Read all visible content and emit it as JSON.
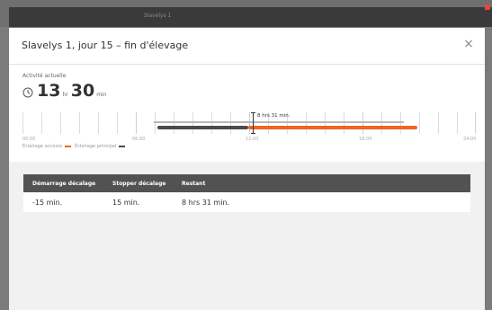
{
  "window": {
    "title": "Slavelys 1"
  },
  "dialog": {
    "title": "Slavelys 1, jour 15 – fin d'élevage",
    "close_label": "×"
  },
  "activity": {
    "label": "Activité actuelle",
    "hours": "13",
    "hours_unit": "hr",
    "minutes": "30",
    "minutes_unit": "min"
  },
  "timeline": {
    "marker_label": "8 hrs 31 min.",
    "ticks": [
      "00:00",
      "06:00",
      "12:00",
      "18:00",
      "24:00"
    ],
    "legend": {
      "secondary_label": "Éclairage accésre",
      "primary_label": "Éclairage principal"
    },
    "colors": {
      "secondary": "#f0651f",
      "primary": "#4b4b4b",
      "track": "#b8b8b8"
    }
  },
  "table": {
    "headers": [
      "Démarrage décalage",
      "Stopper décalage",
      "Restant"
    ],
    "rows": [
      [
        "-15 min.",
        "15 min.",
        "8 hrs 31 min."
      ]
    ]
  }
}
